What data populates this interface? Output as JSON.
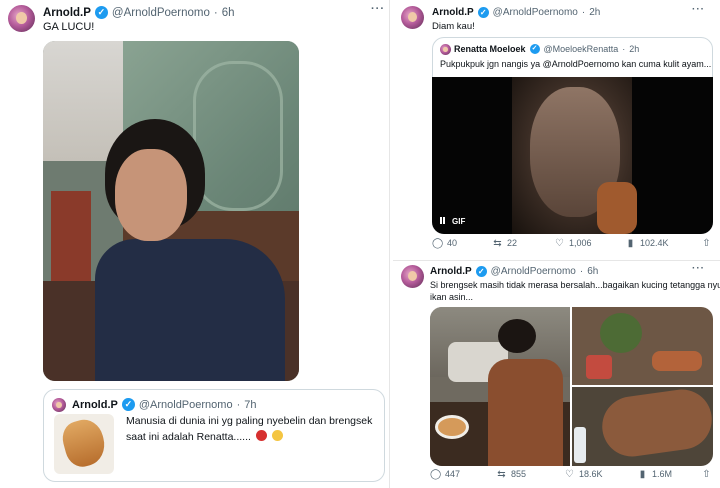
{
  "left_tweet": {
    "name": "Arnold.P",
    "handle": "@ArnoldPoernomo",
    "time": "6h",
    "text": "GA LUCU!",
    "more": "···",
    "quoted": {
      "name": "Arnold.P",
      "handle": "@ArnoldPoernomo",
      "time": "7h",
      "line1": "Manusia di dunia ini yg paling nyebelin dan brengsek",
      "line2": "saat ini adalah Renatta......"
    }
  },
  "right_top_tweet": {
    "name": "Arnold.P",
    "handle": "@ArnoldPoernomo",
    "time": "2h",
    "text": "Diam kau!",
    "more": "···",
    "quoted": {
      "name": "Renatta Moeloek",
      "handle": "@MoeloekRenatta",
      "time": "2h",
      "text": "Pukpukpuk jgn nangis ya @ArnoldPoernomo kan cuma kulit ayam...",
      "media_badge": "GIF"
    },
    "actions": {
      "replies": "40",
      "retweets": "22",
      "likes": "1,006",
      "views": "102.4K"
    }
  },
  "right_bottom_tweet": {
    "name": "Arnold.P",
    "handle": "@ArnoldPoernomo",
    "time": "6h",
    "line1": "Si brengsek masih tidak merasa bersalah...bagaikan kucing tetangga nyuri",
    "line2": "ikan asin...",
    "more": "···",
    "actions": {
      "replies": "447",
      "retweets": "855",
      "likes": "18.6K",
      "views": "1.6M"
    }
  },
  "icons": [
    "verified-badge",
    "reply-icon",
    "retweet-icon",
    "like-icon",
    "views-icon",
    "share-icon",
    "pause-icon"
  ],
  "colors": {
    "verified": "#1d9bf0",
    "text": "#0f1419",
    "muted": "#536471",
    "border": "#cfd9de"
  }
}
